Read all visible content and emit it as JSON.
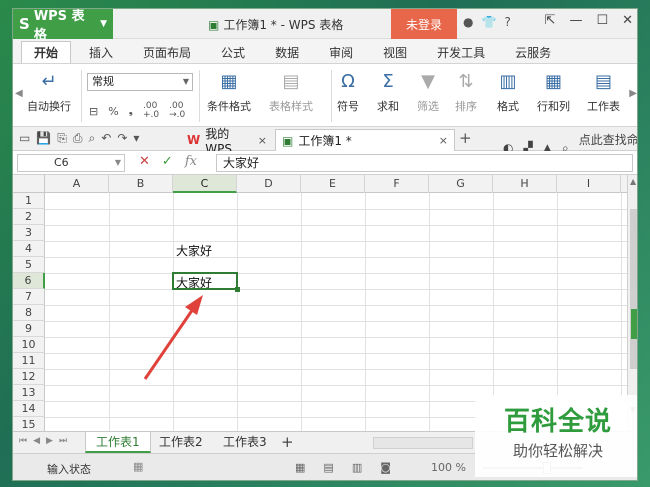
{
  "titlebar": {
    "app_name": "WPS 表格",
    "app_logo": "S",
    "document_title": "工作簿1 * - WPS 表格",
    "login_label": "未登录",
    "help_label": "?"
  },
  "ribbon_tabs": [
    "开始",
    "插入",
    "页面布局",
    "公式",
    "数据",
    "审阅",
    "视图",
    "开发工具",
    "云服务"
  ],
  "ribbon": {
    "wrap_text": "自动换行",
    "number_format": "常规",
    "percent": "%",
    "thousands": "⁹",
    "dec_inc": ".00\n+.0",
    "dec_dec": ".00\n→.0",
    "conditional_format": "条件格式",
    "table_style": "表格样式",
    "symbol": "符号",
    "sum": "求和",
    "filter": "筛选",
    "sort": "排序",
    "format": "格式",
    "rows_cols": "行和列",
    "worksheet": "工作表"
  },
  "doc_tabs": [
    {
      "label": "我的WPS",
      "close": "×"
    },
    {
      "label": "工作簿1 *",
      "close": "×"
    }
  ],
  "right_tools": {
    "search": "点此查找命令"
  },
  "formula_bar": {
    "name_box": "C6",
    "fx": "fx",
    "content": "大家好"
  },
  "columns": [
    "A",
    "B",
    "C",
    "D",
    "E",
    "F",
    "G",
    "H",
    "I"
  ],
  "rows": [
    "1",
    "2",
    "3",
    "4",
    "5",
    "6",
    "7",
    "8",
    "9",
    "10",
    "11",
    "12",
    "13",
    "14",
    "15"
  ],
  "cells": {
    "C4": "大家好",
    "C6": "大家好"
  },
  "sheets": [
    "工作表1",
    "工作表2",
    "工作表3"
  ],
  "status": {
    "mode": "输入状态",
    "zoom": "100 %"
  },
  "watermark": {
    "main": "百科全说",
    "sub": "助你轻松解决"
  },
  "colors": {
    "accent": "#3f9e46",
    "login": "#e8674a",
    "arrow": "#e0413a"
  }
}
